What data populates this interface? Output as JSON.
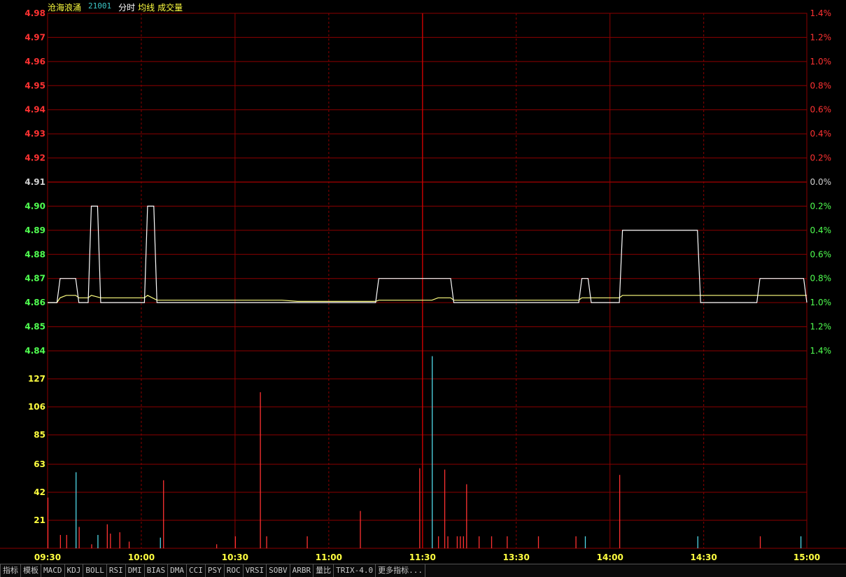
{
  "header": {
    "stock_name": "沧海浪涌",
    "stock_code": "21001",
    "mode_label": "分时",
    "avg_label": "均线",
    "volume_label": "成交量"
  },
  "colors": {
    "up": "#ff3232",
    "down": "#50ff50",
    "neutral": "#d0d0d0",
    "volume_axis": "#ffff40",
    "price_line": "#ffffff",
    "avg_line": "#ffff80",
    "vol_up": "#ff3232",
    "vol_down": "#50d8e8"
  },
  "chart_data": {
    "type": "line",
    "prev_close": 4.91,
    "price_axis": {
      "ticks": [
        "4.98",
        "4.97",
        "4.96",
        "4.95",
        "4.94",
        "4.93",
        "4.92",
        "4.91",
        "4.90",
        "4.89",
        "4.88",
        "4.87",
        "4.86",
        "4.85",
        "4.84"
      ],
      "ylim": [
        4.84,
        4.98
      ]
    },
    "pct_axis": {
      "ticks": [
        "1.4%",
        "1.2%",
        "1.0%",
        "0.8%",
        "0.6%",
        "0.4%",
        "0.2%",
        "0.0%",
        "0.2%",
        "0.4%",
        "0.6%",
        "0.8%",
        "1.0%",
        "1.2%",
        "1.4%"
      ]
    },
    "volume_axis": {
      "ticks": [
        "127",
        "106",
        "85",
        "63",
        "42",
        "21"
      ],
      "ylim": [
        0,
        148
      ]
    },
    "time_labels": [
      "09:30",
      "10:00",
      "10:30",
      "11:00",
      "11:30",
      "13:30",
      "14:00",
      "14:30",
      "15:00"
    ],
    "price_series": [
      [
        0,
        4.86
      ],
      [
        3,
        4.86
      ],
      [
        4,
        4.87
      ],
      [
        9,
        4.87
      ],
      [
        10,
        4.86
      ],
      [
        13,
        4.86
      ],
      [
        14,
        4.9
      ],
      [
        16,
        4.9
      ],
      [
        17,
        4.86
      ],
      [
        31,
        4.86
      ],
      [
        32,
        4.9
      ],
      [
        34,
        4.9
      ],
      [
        35,
        4.86
      ],
      [
        105,
        4.86
      ],
      [
        106,
        4.87
      ],
      [
        129,
        4.87
      ],
      [
        130,
        4.86
      ],
      [
        170,
        4.86
      ],
      [
        171,
        4.87
      ],
      [
        173,
        4.87
      ],
      [
        174,
        4.86
      ],
      [
        183,
        4.86
      ],
      [
        184,
        4.89
      ],
      [
        208,
        4.89
      ],
      [
        209,
        4.86
      ],
      [
        227,
        4.86
      ],
      [
        228,
        4.87
      ],
      [
        242,
        4.87
      ],
      [
        243,
        4.86
      ]
    ],
    "avg_series": [
      [
        0,
        4.86
      ],
      [
        3,
        4.86
      ],
      [
        4,
        4.862
      ],
      [
        6,
        4.863
      ],
      [
        9,
        4.863
      ],
      [
        10,
        4.862
      ],
      [
        13,
        4.862
      ],
      [
        14,
        4.863
      ],
      [
        17,
        4.862
      ],
      [
        31,
        4.862
      ],
      [
        32,
        4.863
      ],
      [
        35,
        4.861
      ],
      [
        60,
        4.861
      ],
      [
        75,
        4.861
      ],
      [
        80,
        4.8605
      ],
      [
        105,
        4.8605
      ],
      [
        106,
        4.861
      ],
      [
        123,
        4.861
      ],
      [
        125,
        4.862
      ],
      [
        129,
        4.862
      ],
      [
        130,
        4.861
      ],
      [
        160,
        4.861
      ],
      [
        170,
        4.861
      ],
      [
        171,
        4.862
      ],
      [
        183,
        4.862
      ],
      [
        184,
        4.863
      ],
      [
        208,
        4.863
      ],
      [
        209,
        4.863
      ],
      [
        243,
        4.863
      ]
    ],
    "volume": [
      [
        0,
        38,
        "up"
      ],
      [
        4,
        10,
        "up"
      ],
      [
        6,
        10,
        "up"
      ],
      [
        9,
        57,
        "down"
      ],
      [
        10,
        16,
        "up"
      ],
      [
        14,
        3,
        "up"
      ],
      [
        16,
        10,
        "down"
      ],
      [
        19,
        18,
        "up"
      ],
      [
        20,
        11,
        "up"
      ],
      [
        23,
        12,
        "up"
      ],
      [
        26,
        5,
        "up"
      ],
      [
        36,
        8,
        "down"
      ],
      [
        37,
        51,
        "up"
      ],
      [
        54,
        3,
        "up"
      ],
      [
        60,
        9,
        "up"
      ],
      [
        68,
        117,
        "up"
      ],
      [
        70,
        9,
        "up"
      ],
      [
        83,
        9,
        "up"
      ],
      [
        100,
        28,
        "up"
      ],
      [
        119,
        60,
        "up"
      ],
      [
        123,
        144,
        "down"
      ],
      [
        125,
        9,
        "up"
      ],
      [
        127,
        59,
        "up"
      ],
      [
        128,
        9,
        "up"
      ],
      [
        131,
        9,
        "up"
      ],
      [
        132,
        9,
        "up"
      ],
      [
        133,
        9,
        "up"
      ],
      [
        134,
        48,
        "up"
      ],
      [
        138,
        9,
        "up"
      ],
      [
        142,
        9,
        "up"
      ],
      [
        147,
        9,
        "up"
      ],
      [
        157,
        9,
        "up"
      ],
      [
        169,
        9,
        "up"
      ],
      [
        172,
        9,
        "down"
      ],
      [
        183,
        55,
        "up"
      ],
      [
        208,
        9,
        "down"
      ],
      [
        228,
        9,
        "up"
      ],
      [
        241,
        9,
        "down"
      ]
    ]
  },
  "toolbar": {
    "tabs": [
      "指标",
      "模板",
      "MACD",
      "KDJ",
      "BOLL",
      "RSI",
      "DMI",
      "BIAS",
      "DMA",
      "CCI",
      "PSY",
      "ROC",
      "VRSI",
      "SOBV",
      "ARBR",
      "量比",
      "TRIX-4.0",
      "更多指标..."
    ]
  }
}
